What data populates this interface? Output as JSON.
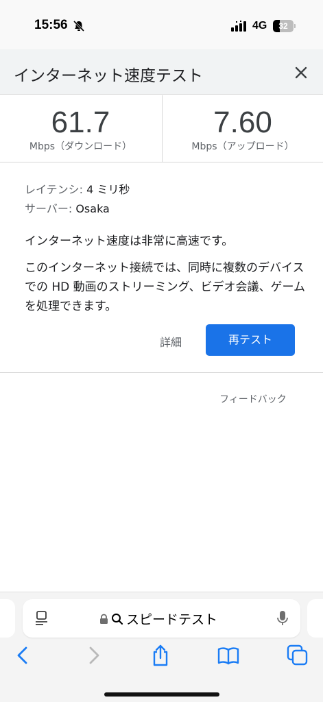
{
  "status_bar": {
    "time": "15:56",
    "network": "4G",
    "battery": "32",
    "battery_fraction": 0.32,
    "icons": [
      "bell-muted-icon",
      "signal-icon",
      "battery-icon"
    ]
  },
  "header": {
    "title": "インターネット速度テスト",
    "close_icon": "close-icon"
  },
  "results": {
    "download": {
      "value": "61.7",
      "unit": "Mbps（ダウンロード）"
    },
    "upload": {
      "value": "7.60",
      "unit": "Mbps（アップロード）"
    }
  },
  "info": {
    "latency_label": "レイテンシ: ",
    "latency_value": "4 ミリ秒",
    "server_label": "サーバー: ",
    "server_value": "Osaka",
    "summary": "インターネット速度は非常に高速です。",
    "description": "このインターネット接続では、同時に複数のデバイスでの HD 動画のストリーミング、ビデオ会議、ゲームを処理できます。",
    "details_label": "詳細",
    "retest_label": "再テスト"
  },
  "feedback_label": "フィードバック",
  "browser": {
    "address_text": "スピードテスト",
    "icons": [
      "reader-icon",
      "lock-icon",
      "search-icon",
      "mic-icon",
      "back-icon",
      "forward-icon",
      "share-icon",
      "bookmarks-icon",
      "tabs-icon"
    ]
  },
  "colors": {
    "accent": "#1a73e8",
    "header_bg": "#f1f3f4",
    "ios_blue": "#1a7cf5"
  }
}
